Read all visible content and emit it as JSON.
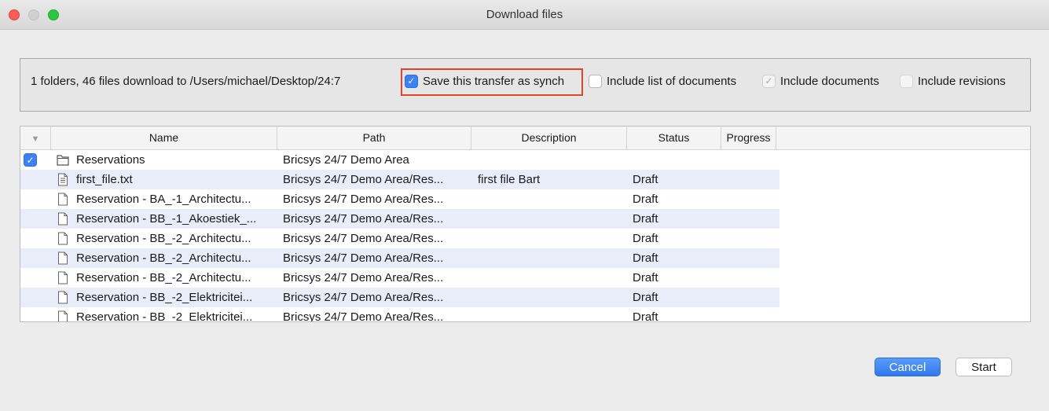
{
  "window": {
    "title": "Download files"
  },
  "options": {
    "summary": "1 folders, 46 files download to /Users/michael/Desktop/24:7",
    "save_synch_label": "Save this transfer as synch",
    "include_list_label": "Include list of documents",
    "include_documents_label": "Include documents",
    "include_revisions_label": "Include revisions",
    "save_synch_checked": true,
    "include_list_checked": false,
    "include_documents_checked": true,
    "include_documents_disabled": true,
    "include_revisions_checked": false,
    "include_revisions_disabled": true
  },
  "table": {
    "columns": {
      "name": "Name",
      "path": "Path",
      "description": "Description",
      "status": "Status",
      "progress": "Progress"
    },
    "rows": [
      {
        "type": "folder",
        "checked": true,
        "name": "Reservations",
        "path": "Bricsys 24/7 Demo Area",
        "description": "",
        "status": ""
      },
      {
        "type": "text-file",
        "checked": false,
        "name": "first_file.txt",
        "path": "Bricsys 24/7 Demo Area/Res...",
        "description": "first file Bart",
        "status": "Draft"
      },
      {
        "type": "file",
        "checked": false,
        "name": "Reservation - BA_-1_Architectu...",
        "path": "Bricsys 24/7 Demo Area/Res...",
        "description": "",
        "status": "Draft"
      },
      {
        "type": "file",
        "checked": false,
        "name": "Reservation - BB_-1_Akoestiek_...",
        "path": "Bricsys 24/7 Demo Area/Res...",
        "description": "",
        "status": "Draft"
      },
      {
        "type": "file",
        "checked": false,
        "name": "Reservation - BB_-2_Architectu...",
        "path": "Bricsys 24/7 Demo Area/Res...",
        "description": "",
        "status": "Draft"
      },
      {
        "type": "file",
        "checked": false,
        "name": "Reservation - BB_-2_Architectu...",
        "path": "Bricsys 24/7 Demo Area/Res...",
        "description": "",
        "status": "Draft"
      },
      {
        "type": "file",
        "checked": false,
        "name": "Reservation - BB_-2_Architectu...",
        "path": "Bricsys 24/7 Demo Area/Res...",
        "description": "",
        "status": "Draft"
      },
      {
        "type": "file",
        "checked": false,
        "name": "Reservation - BB_-2_Elektricitei...",
        "path": "Bricsys 24/7 Demo Area/Res...",
        "description": "",
        "status": "Draft"
      },
      {
        "type": "file",
        "checked": false,
        "name": "Reservation - BB_-2_Elektricitei...",
        "path": "Bricsys 24/7 Demo Area/Res...",
        "description": "",
        "status": "Draft"
      }
    ]
  },
  "buttons": {
    "cancel": "Cancel",
    "start": "Start"
  },
  "colors": {
    "accent": "#3b82f6",
    "highlight_border": "#e2442b",
    "row_alt": "#e9edfa"
  }
}
